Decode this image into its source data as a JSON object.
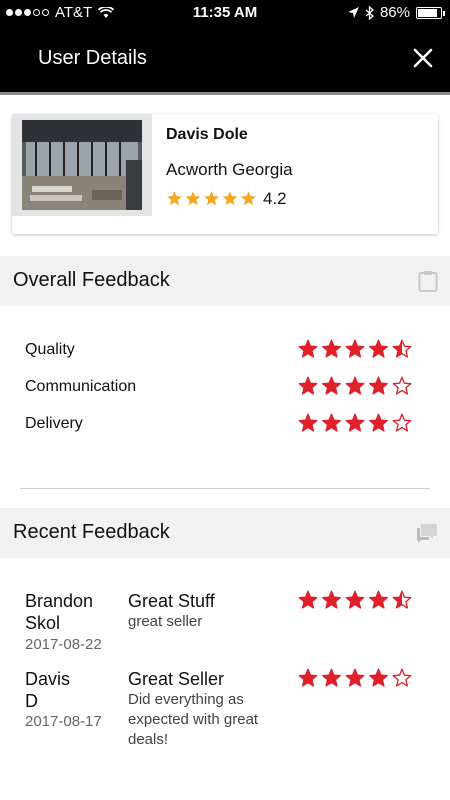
{
  "status_bar": {
    "carrier": "AT&T",
    "time": "11:35 AM",
    "battery": "86%",
    "battery_level": 0.86
  },
  "header": {
    "title": "User Details",
    "close_icon": "close-icon"
  },
  "user": {
    "name": "Davis Dole",
    "location": "Acworth Georgia",
    "rating": 4.2,
    "rating_text": "4.2",
    "star_color": "#f5a623"
  },
  "overall_feedback": {
    "title": "Overall Feedback",
    "icon": "clipboard-icon",
    "star_color": "#e0202a",
    "items": [
      {
        "label": "Quality",
        "rating": 4.5
      },
      {
        "label": "Communication",
        "rating": 4
      },
      {
        "label": "Delivery",
        "rating": 4
      }
    ]
  },
  "recent_feedback": {
    "title": "Recent Feedback",
    "icon": "chat-icon",
    "reviews": [
      {
        "reviewer_first": "Brandon",
        "reviewer_last": "Skol",
        "date": "2017-08-22",
        "title": "Great Stuff",
        "body": "great seller",
        "rating": 4.5
      },
      {
        "reviewer_first": "Davis",
        "reviewer_last": "D",
        "date": "2017-08-17",
        "title": "Great Seller",
        "body": "Did everything as expected with great deals!",
        "rating": 4
      }
    ]
  }
}
